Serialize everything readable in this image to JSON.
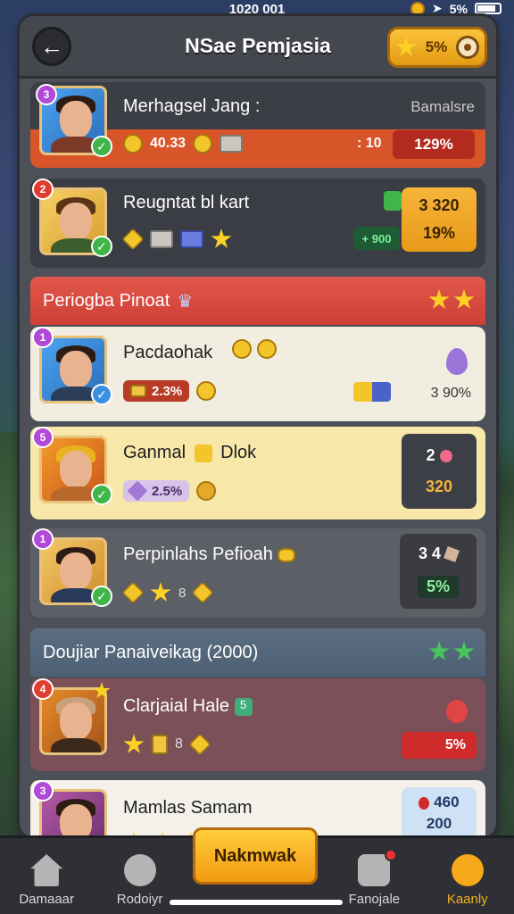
{
  "status": {
    "time": "1020 001",
    "battery": "5%"
  },
  "header": {
    "title": "NSae Pemjasia",
    "currency_value": "5%"
  },
  "cards": [
    {
      "name": "Merhagsel Jang :",
      "right_label": "Bamalsre",
      "stat1": "40.33",
      "stat2": ": 10",
      "stat3": "129%",
      "level": "3"
    },
    {
      "name": "Reugntat bl kart",
      "box_top": "3 320",
      "box_bottom": "19%",
      "green_value": "+ 900",
      "level": "2"
    }
  ],
  "section1": {
    "title": "Periogba Pinoat"
  },
  "cards2": [
    {
      "name": "Pacdaohak",
      "chip": "2.3%",
      "right_value": "3 90%"
    },
    {
      "name": "Ganmal",
      "name_suffix": "Dlok",
      "chip": "2.5%",
      "box_top": "2",
      "box_bottom": "320"
    },
    {
      "name": "Perpinlahs Pefioah",
      "box_top": "3 4",
      "box_bottom": "5%"
    }
  ],
  "section2": {
    "title": "Doujiar Panaiveikag (2000)"
  },
  "cards3": [
    {
      "name": "Clarjaial Hale",
      "badge": "5",
      "box_value": "5%"
    },
    {
      "name": "Mamlas Samam",
      "box_top": "460",
      "box_bottom": "200"
    }
  ],
  "tabbar": {
    "tabs": [
      "Damaaar",
      "Rodoiyr",
      "Fanojale",
      "Kaanly"
    ],
    "center_button": "Nakmwak"
  },
  "colors": {
    "accent": "#f4a81a",
    "red_band": "#d9463b",
    "panel": "#4d5058"
  }
}
